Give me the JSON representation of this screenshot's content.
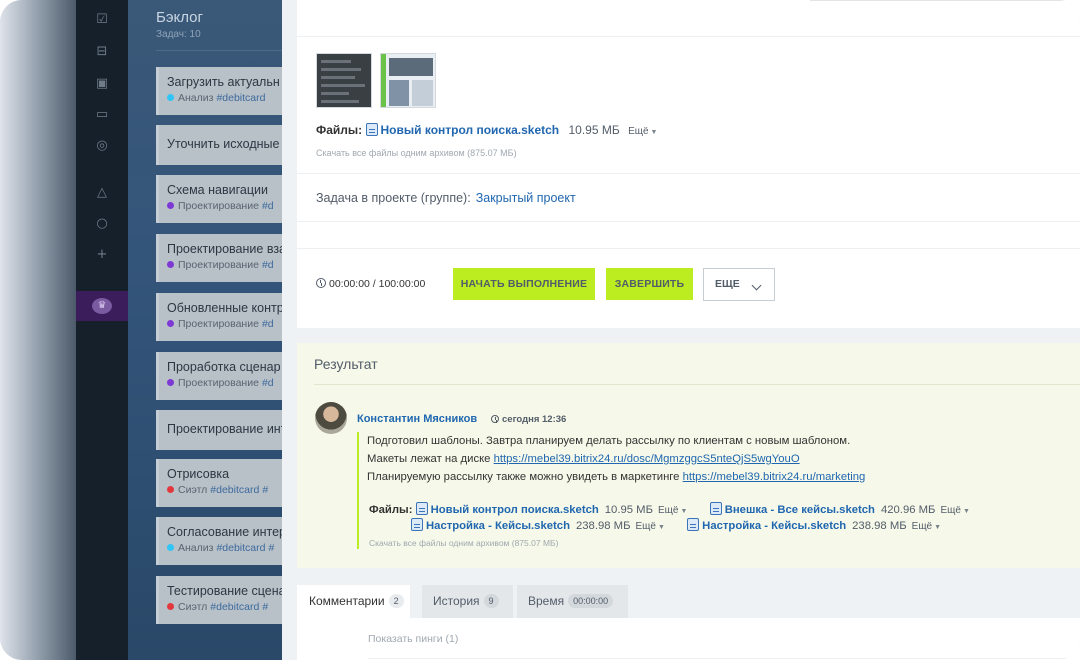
{
  "backlog": {
    "title": "Бэклог",
    "count": "Задач: 10",
    "cards": [
      {
        "title": "Загрузить актуальн",
        "tag_label": "Анализ",
        "tag_color": "#2fc6f6",
        "hashtag": "#debitcard"
      },
      {
        "title": "Уточнить исходные д"
      },
      {
        "title": "Схема навигации",
        "tag_label": "Проектирование",
        "tag_color": "#7e39d5",
        "hashtag": "#d"
      },
      {
        "title": "Проектирование вза",
        "tag_label": "Проектирование",
        "tag_color": "#7e39d5",
        "hashtag": "#d"
      },
      {
        "title": "Обновленные контр",
        "tag_label": "Проектирование",
        "tag_color": "#7e39d5",
        "hashtag": "#d"
      },
      {
        "title": "Проработка сценар",
        "tag_label": "Проектирование",
        "tag_color": "#7e39d5",
        "hashtag": "#d"
      },
      {
        "title": "Проектирование инт"
      },
      {
        "title": "Отрисовка",
        "tag_label": "Сиэтл",
        "tag_color": "#e2383d",
        "hashtag": "#debitcard",
        "extra": "#"
      },
      {
        "title": "Согласование интер",
        "tag_label": "Анализ",
        "tag_color": "#2fc6f6",
        "hashtag": "#debitcard",
        "extra": "#"
      },
      {
        "title": "Тестирование сцена",
        "tag_label": "Сиэтл",
        "tag_color": "#e2383d",
        "hashtag": "#debitcard",
        "extra": "#"
      }
    ]
  },
  "task": {
    "files_label": "Файлы:",
    "file_name": "Новый контрол поиска.sketch",
    "file_size": "10.95 МБ",
    "more_label": "Ещё",
    "archive_text": "Скачать все файлы одним архивом (875.07 МБ)",
    "project_label": "Задача в проекте (группе):",
    "project_name": "Закрытый проект",
    "timer": "00:00:00 / 100:00:00",
    "start_button": "НАЧАТЬ ВЫПОЛНЕНИЕ",
    "finish_button": "ЗАВЕРШИТЬ",
    "more_button": "ЕЩЕ"
  },
  "result": {
    "title": "Результат",
    "author": "Константин Мясников",
    "date": "сегодня 12:36",
    "line1": "Подготовил шаблоны. Завтра планируем делать рассылку по клиентам с новым шаблоном.",
    "line2_prefix": "Макеты лежат на диске",
    "line2_link": "https://mebel39.bitrix24.ru/dosc/MgmzggcS5nteQjS5wgYouO",
    "line3_prefix": "Планируемую рассылку также можно увидеть в маркетинге",
    "line3_link": "https://mebel39.bitrix24.ru/marketing",
    "files_label": "Файлы:",
    "files": [
      {
        "name": "Новый контрол поиска.sketch",
        "size": "10.95 МБ"
      },
      {
        "name": "Внешка - Все кейсы.sketch",
        "size": "420.96 МБ"
      },
      {
        "name": "Настройка - Кейсы.sketch",
        "size": "238.98 МБ"
      },
      {
        "name": "Настройка - Кейсы.sketch",
        "size": "238.98 МБ"
      }
    ],
    "more_label": "Ещё",
    "archive_text": "Скачать все файлы одним архивом (875.07 МБ)"
  },
  "tabs": [
    {
      "label": "Комментарии",
      "badge": "2"
    },
    {
      "label": "История",
      "badge": "9"
    },
    {
      "label": "Время",
      "badge": "00:00:00"
    }
  ],
  "bottom": {
    "show_pings": "Показать пинги (1)"
  },
  "colors": {
    "accent_green": "#bbed21",
    "link_blue": "#2067b0",
    "result_bg": "#f6f9e9"
  }
}
